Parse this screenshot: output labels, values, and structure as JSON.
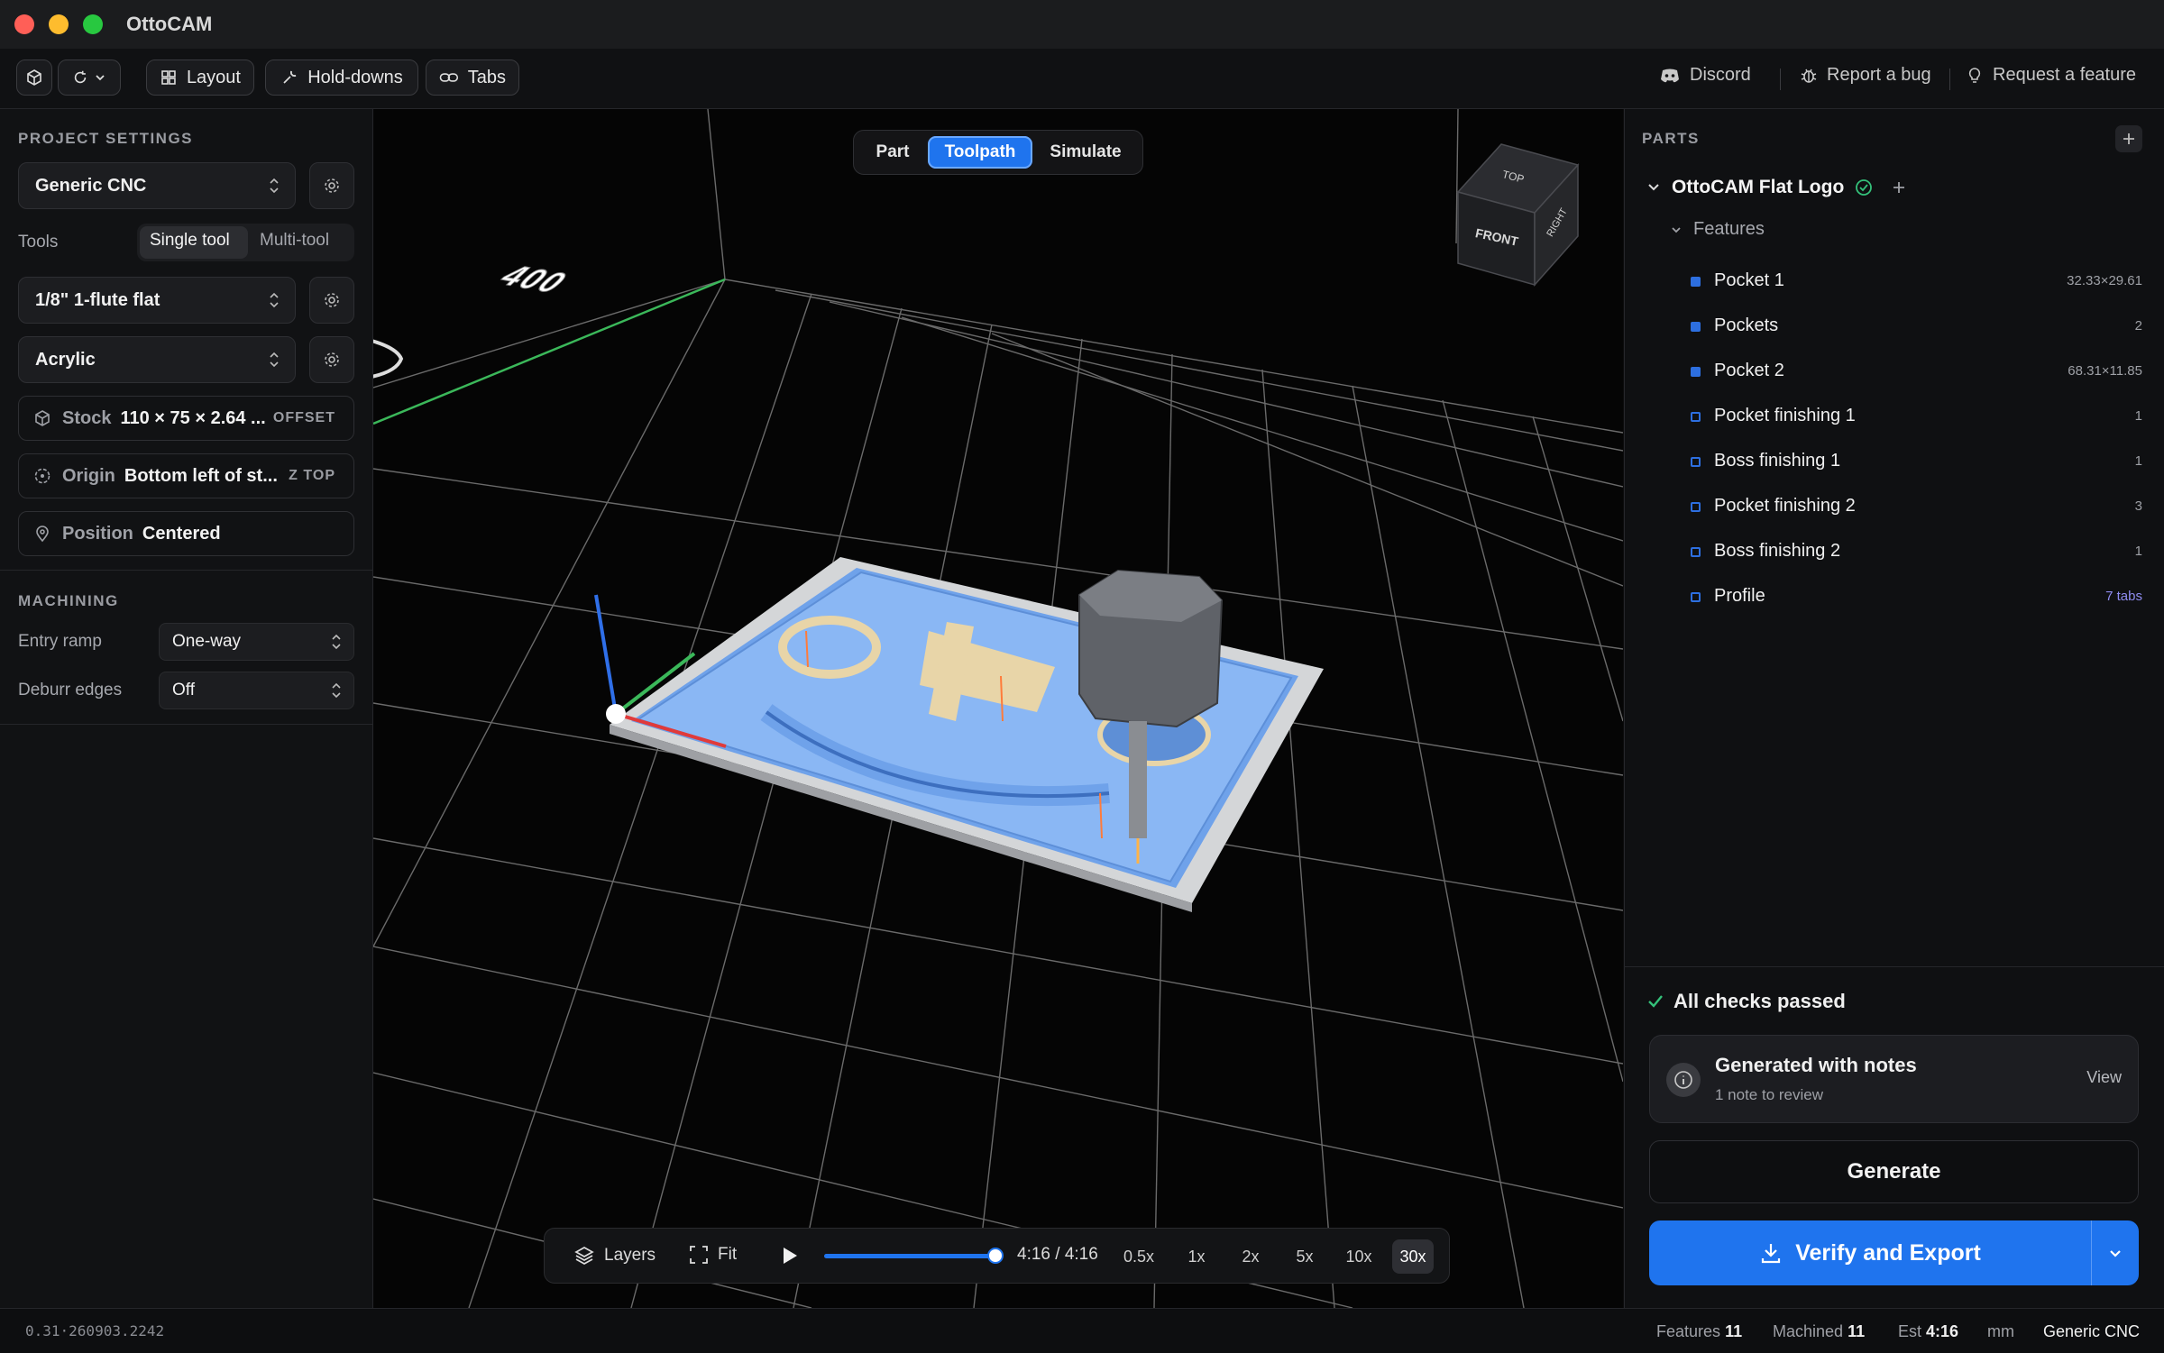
{
  "window": {
    "title": "OttoCAM"
  },
  "toolbar": {
    "layout_label": "Layout",
    "holddowns_label": "Hold-downs",
    "tabs_label": "Tabs",
    "discord_label": "Discord",
    "bug_label": "Report a bug",
    "feature_label": "Request a feature"
  },
  "project": {
    "title": "PROJECT SETTINGS",
    "machine": "Generic CNC",
    "tools_label": "Tools",
    "tool_mode_single": "Single tool",
    "tool_mode_multi": "Multi-tool",
    "tool": "1/8\" 1-flute flat",
    "material": "Acrylic",
    "stock_label": "Stock",
    "stock_value": "110 × 75 × 2.64 ...",
    "stock_tag": "OFFSET",
    "origin_label": "Origin",
    "origin_value": "Bottom left of st...",
    "origin_tag": "Z TOP",
    "position_label": "Position",
    "position_value": "Centered"
  },
  "machining": {
    "title": "MACHINING",
    "entry_ramp_label": "Entry ramp",
    "entry_ramp_value": "One-way",
    "deburr_label": "Deburr edges",
    "deburr_value": "Off"
  },
  "viewport": {
    "tabs": [
      "Part",
      "Toolpath",
      "Simulate"
    ],
    "active_tab": "Toolpath",
    "cube_top": "TOP",
    "cube_front": "FRONT",
    "cube_right": "RIGHT",
    "scale_label": "400"
  },
  "playback": {
    "layers_label": "Layers",
    "fit_label": "Fit",
    "time": "4:16 / 4:16",
    "progress": 1.0,
    "speeds": [
      "0.5x",
      "1x",
      "2x",
      "5x",
      "10x",
      "30x"
    ],
    "active_speed": "30x"
  },
  "parts": {
    "title": "PARTS",
    "part_name": "OttoCAM Flat Logo",
    "features_label": "Features",
    "features": [
      {
        "name": "Pocket 1",
        "value": "32.33×29.61",
        "filled": true
      },
      {
        "name": "Pockets",
        "value": "2",
        "filled": true
      },
      {
        "name": "Pocket 2",
        "value": "68.31×11.85",
        "filled": true
      },
      {
        "name": "Pocket finishing 1",
        "value": "1",
        "filled": false
      },
      {
        "name": "Boss finishing 1",
        "value": "1",
        "filled": false
      },
      {
        "name": "Pocket finishing 2",
        "value": "3",
        "filled": false
      },
      {
        "name": "Boss finishing 2",
        "value": "1",
        "filled": false
      },
      {
        "name": "Profile",
        "value": "7 tabs",
        "filled": false
      }
    ]
  },
  "checks": {
    "status": "All checks passed",
    "notes_title": "Generated with notes",
    "notes_sub": "1 note to review",
    "view_label": "View",
    "generate_label": "Generate",
    "export_label": "Verify and Export"
  },
  "statusbar": {
    "coords": "0.31·260903.2242",
    "features_label": "Features",
    "features_value": "11",
    "machined_label": "Machined",
    "machined_value": "11",
    "est_label": "Est",
    "est_value": "4:16",
    "units": "mm",
    "machine": "Generic CNC"
  },
  "colors": {
    "accent": "#1f74ee",
    "success": "#34c17a",
    "feature_blue": "#2d6fe0"
  }
}
